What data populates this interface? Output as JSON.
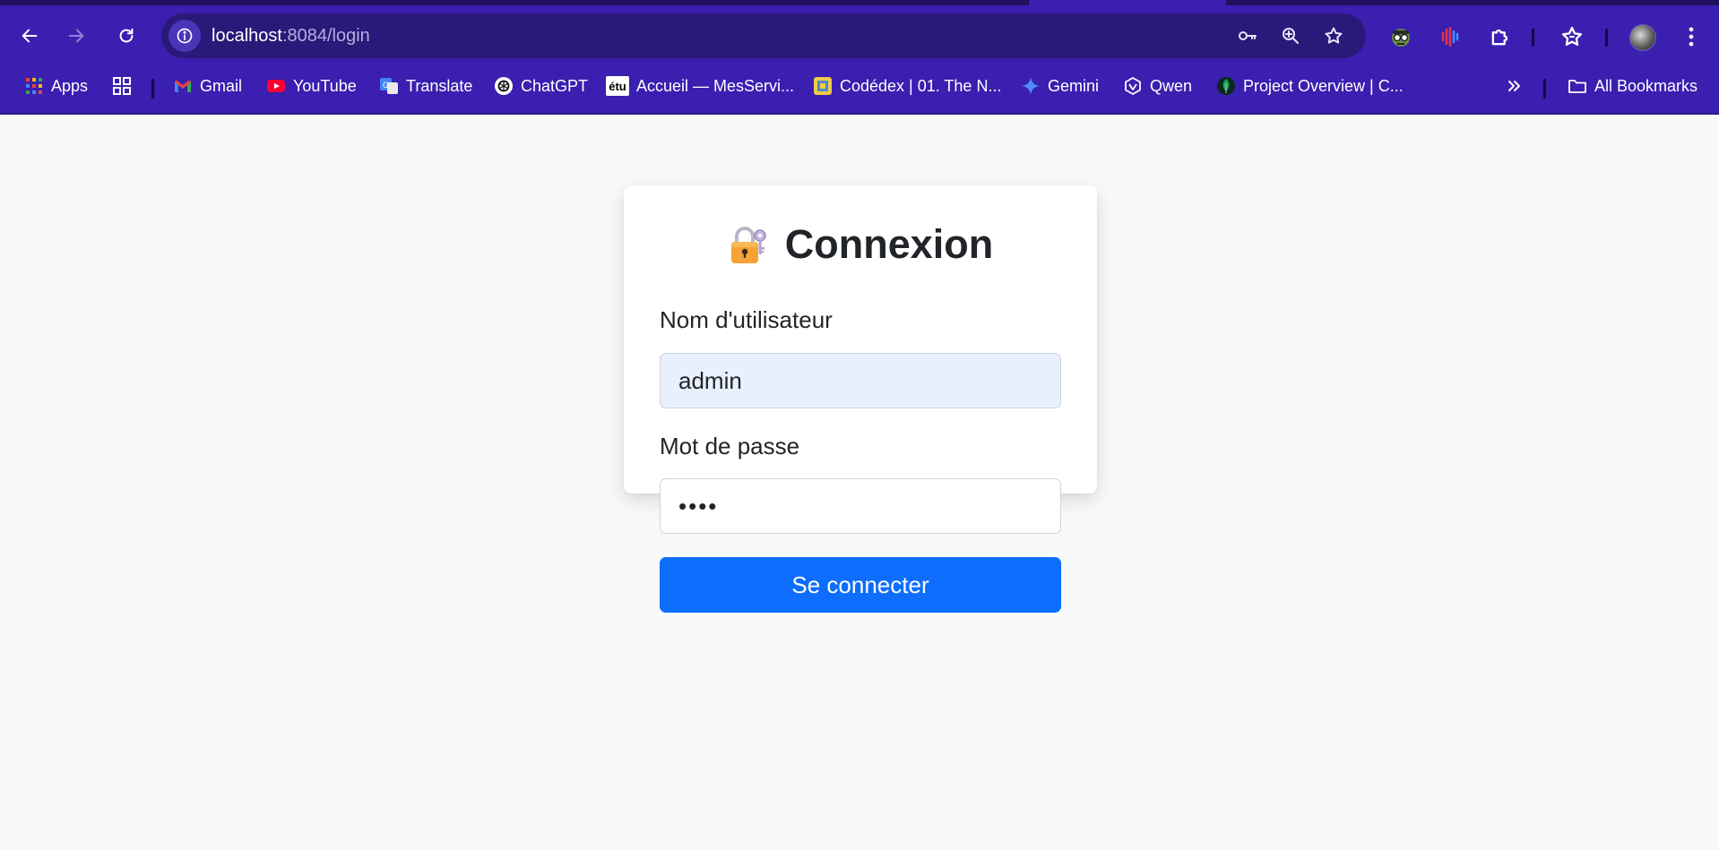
{
  "browser": {
    "url_host": "localhost",
    "url_rest": ":8084/login",
    "bookmarks": [
      {
        "label": "Apps",
        "icon": "apps-grid-icon"
      },
      {
        "label": "",
        "icon": "tab-groups-icon"
      },
      {
        "label": "Gmail",
        "icon": "gmail-icon"
      },
      {
        "label": "YouTube",
        "icon": "youtube-icon"
      },
      {
        "label": "Translate",
        "icon": "google-translate-icon"
      },
      {
        "label": "ChatGPT",
        "icon": "chatgpt-icon"
      },
      {
        "label": "Accueil — MesServi...",
        "icon": "etu-icon"
      },
      {
        "label": "Codédex | 01. The N...",
        "icon": "codedex-icon"
      },
      {
        "label": "Gemini",
        "icon": "gemini-icon"
      },
      {
        "label": "Qwen",
        "icon": "qwen-icon"
      },
      {
        "label": "Project Overview | C...",
        "icon": "mongodb-leaf-icon"
      }
    ],
    "all_bookmarks": "All Bookmarks",
    "etu_badge": "étu"
  },
  "login": {
    "title": "Connexion",
    "username_label": "Nom d'utilisateur",
    "username_value": "admin",
    "password_label": "Mot de passe",
    "password_value": "••••",
    "submit_label": "Se connecter"
  },
  "colors": {
    "chrome": "#3a1fb0",
    "omnibox": "#2a1978",
    "page_bg": "#f8f9fa",
    "primary": "#0d6efd",
    "autofill_bg": "#e8f0fe"
  }
}
